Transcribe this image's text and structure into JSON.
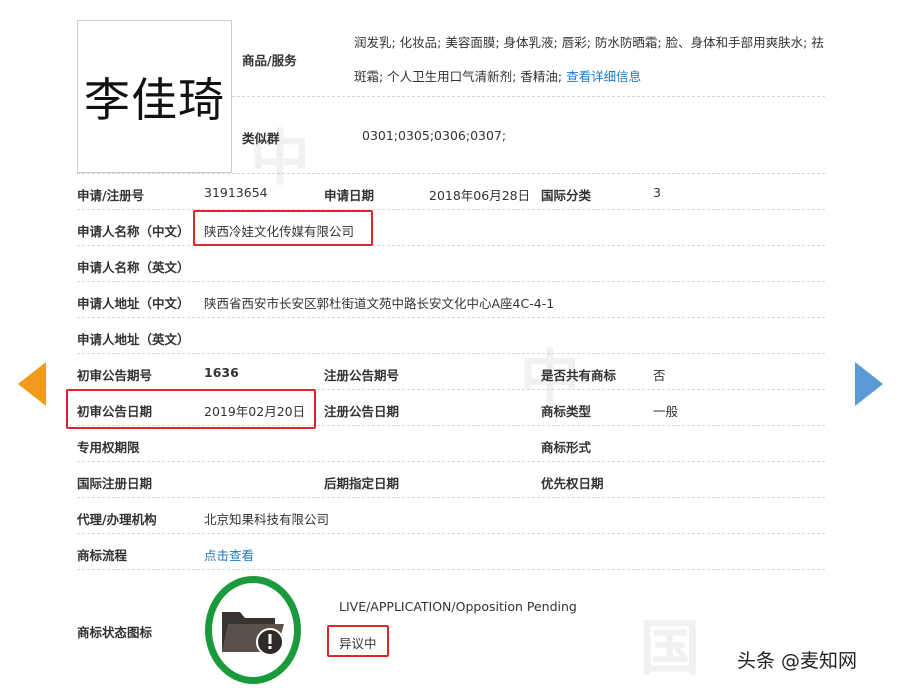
{
  "trademark_name": "李佳琦",
  "goods": {
    "label": "商品/服务",
    "line1": "润发乳; 化妆品; 美容面膜; 身体乳液; 唇彩; 防水防晒霜; 脸、身体和手部用爽肤水; 祛",
    "line2": "斑霜; 个人卫生用口气清新剂; 香精油;",
    "detail_link": "查看详细信息"
  },
  "similar": {
    "label": "类似群",
    "value": "0301;0305;0306;0307;"
  },
  "rows": [
    {
      "l1": "申请/注册号",
      "v1": "31913654",
      "l2": "申请日期",
      "v2": "2018年06月28日",
      "l3": "国际分类",
      "v3": "3"
    },
    {
      "l1": "申请人名称（中文）",
      "v1": "陕西冷娃文化传媒有限公司"
    },
    {
      "l1": "申请人名称（英文）"
    },
    {
      "l1": "申请人地址（中文）",
      "v1": "陕西省西安市长安区郭杜街道文苑中路长安文化中心A座4C-4-1"
    },
    {
      "l1": "申请人地址（英文）"
    },
    {
      "l1": "初审公告期号",
      "v1": "1636",
      "l2": "注册公告期号",
      "l3": "是否共有商标",
      "v3": "否"
    },
    {
      "l1": "初审公告日期",
      "v1": "2019年02月20日",
      "l2": "注册公告日期",
      "l3": "商标类型",
      "v3": "一般"
    },
    {
      "l1": "专用权期限",
      "l3": "商标形式"
    },
    {
      "l1": "国际注册日期",
      "l2": "后期指定日期",
      "l3": "优先权日期"
    },
    {
      "l1": "代理/办理机构",
      "v1": "北京知果科技有限公司"
    },
    {
      "l1": "商标流程",
      "v1": "点击查看"
    }
  ],
  "status": {
    "label": "商标状态图标",
    "en": "LIVE/APPLICATION/Opposition Pending",
    "cn": "异议中"
  },
  "watermark": "头条 @麦知网",
  "colors": {
    "highlight": "#e0262a",
    "link": "#1a7bc9",
    "prev_arrow": "#f39a1e",
    "next_arrow": "#5b9bd5",
    "status_ring": "#1a9a3c"
  }
}
